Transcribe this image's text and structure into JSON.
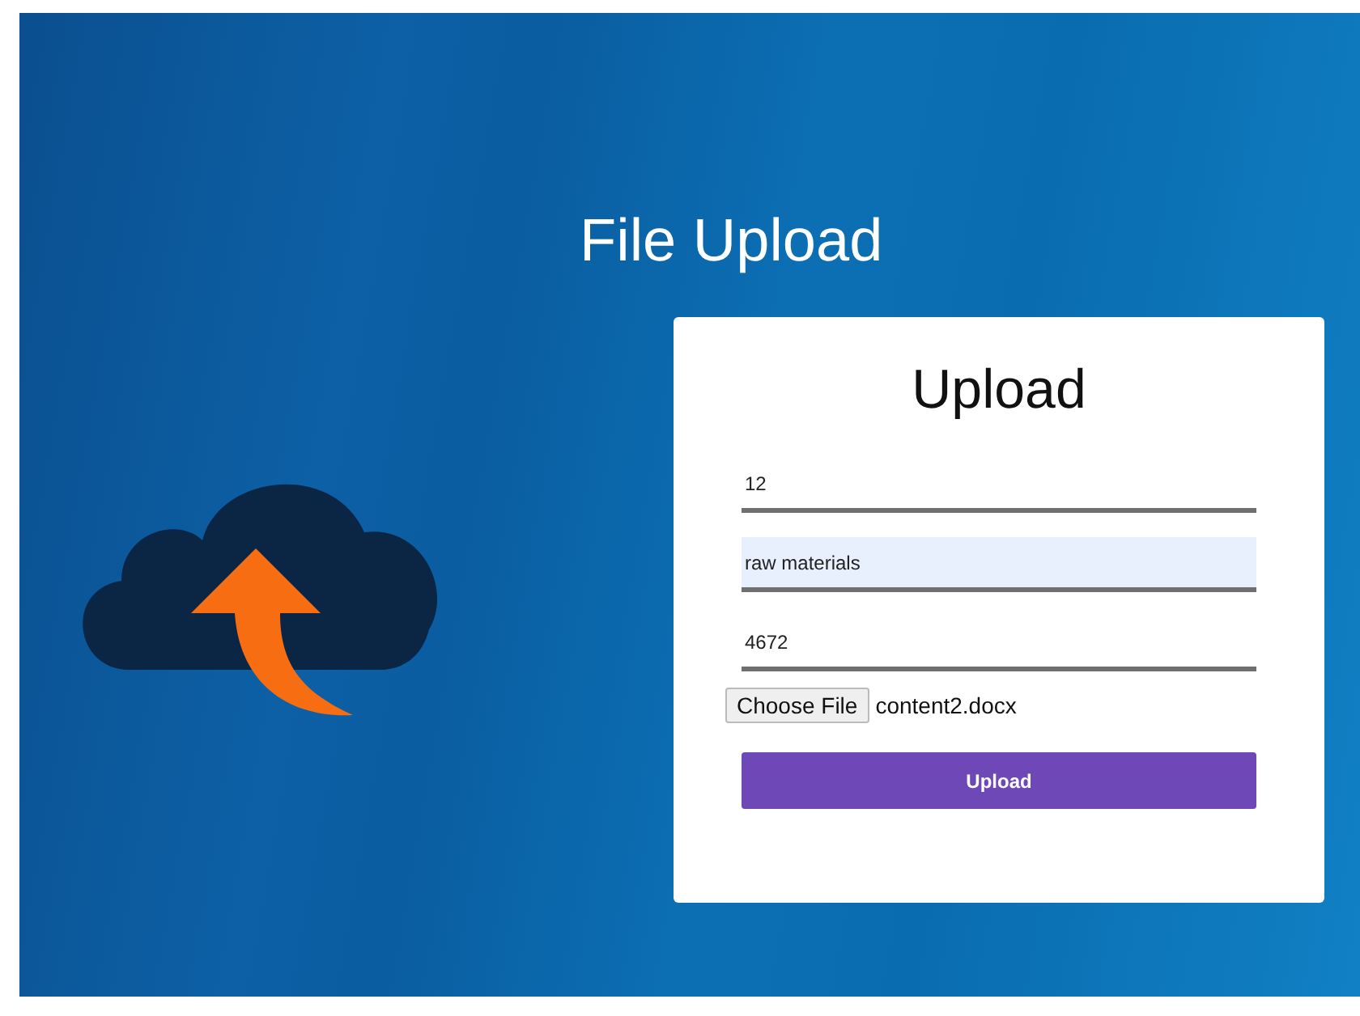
{
  "page": {
    "title": "File Upload"
  },
  "form": {
    "heading": "Upload",
    "fields": [
      {
        "value": "12",
        "autofilled": false
      },
      {
        "value": "raw materials",
        "autofilled": true
      },
      {
        "value": "4672",
        "autofilled": false
      }
    ],
    "file_picker": {
      "button": "Choose File",
      "file_name": "content2.docx"
    },
    "submit": "Upload"
  }
}
